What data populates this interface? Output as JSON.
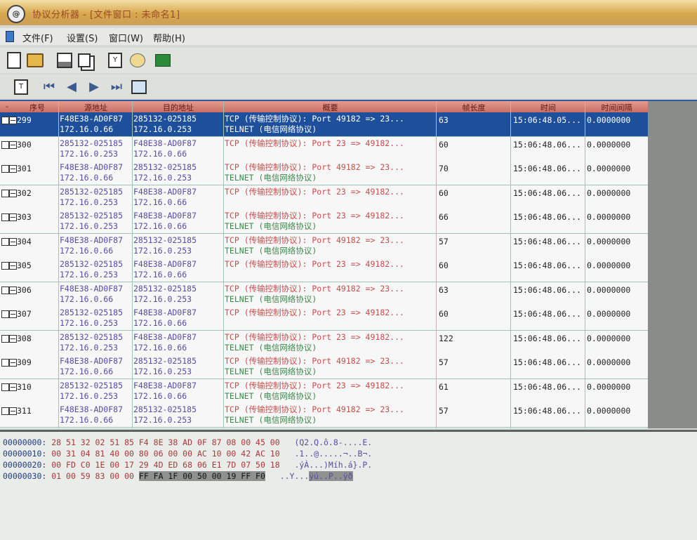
{
  "window": {
    "title": "协议分析器 - [文件窗口 : 未命名1]"
  },
  "menu": [
    "文件(F)",
    "设置(S)",
    "窗口(W)",
    "帮助(H)"
  ],
  "columns": [
    "序号",
    "源地址",
    "目的地址",
    "概要",
    "帧长度",
    "时间",
    "时间间隔"
  ],
  "rows": [
    {
      "seq": "299",
      "src_mac": "F48E38-AD0F87",
      "src_ip": "172.16.0.66",
      "dst_mac": "285132-025185",
      "dst_ip": "172.16.0.253",
      "sum1": "TCP (传输控制协议): Port 49182 => 23...",
      "sum2": "TELNET (电信网络协议)",
      "len": "63",
      "time": "15:06:48.05...",
      "gap": "0.0000000",
      "selected": true
    },
    {
      "seq": "300",
      "src_mac": "285132-025185",
      "src_ip": "172.16.0.253",
      "dst_mac": "F48E38-AD0F87",
      "dst_ip": "172.16.0.66",
      "sum1": "TCP (传输控制协议): Port 23 => 49182...",
      "sum2": "",
      "len": "60",
      "time": "15:06:48.06...",
      "gap": "0.0000000"
    },
    {
      "seq": "301",
      "src_mac": "F48E38-AD0F87",
      "src_ip": "172.16.0.66",
      "dst_mac": "285132-025185",
      "dst_ip": "172.16.0.253",
      "sum1": "TCP (传输控制协议): Port 49182 => 23...",
      "sum2": "TELNET (电信网络协议)",
      "len": "70",
      "time": "15:06:48.06...",
      "gap": "0.0000000"
    },
    {
      "seq": "302",
      "src_mac": "285132-025185",
      "src_ip": "172.16.0.253",
      "dst_mac": "F48E38-AD0F87",
      "dst_ip": "172.16.0.66",
      "sum1": "TCP (传输控制协议): Port 23 => 49182...",
      "sum2": "",
      "len": "60",
      "time": "15:06:48.06...",
      "gap": "0.0000000"
    },
    {
      "seq": "303",
      "src_mac": "285132-025185",
      "src_ip": "172.16.0.253",
      "dst_mac": "F48E38-AD0F87",
      "dst_ip": "172.16.0.66",
      "sum1": "TCP (传输控制协议): Port 23 => 49182...",
      "sum2": "TELNET (电信网络协议)",
      "len": "66",
      "time": "15:06:48.06...",
      "gap": "0.0000000"
    },
    {
      "seq": "304",
      "src_mac": "F48E38-AD0F87",
      "src_ip": "172.16.0.66",
      "dst_mac": "285132-025185",
      "dst_ip": "172.16.0.253",
      "sum1": "TCP (传输控制协议): Port 49182 => 23...",
      "sum2": "TELNET (电信网络协议)",
      "len": "57",
      "time": "15:06:48.06...",
      "gap": "0.0000000"
    },
    {
      "seq": "305",
      "src_mac": "285132-025185",
      "src_ip": "172.16.0.253",
      "dst_mac": "F48E38-AD0F87",
      "dst_ip": "172.16.0.66",
      "sum1": "TCP (传输控制协议): Port 23 => 49182...",
      "sum2": "",
      "len": "60",
      "time": "15:06:48.06...",
      "gap": "0.0000000"
    },
    {
      "seq": "306",
      "src_mac": "F48E38-AD0F87",
      "src_ip": "172.16.0.66",
      "dst_mac": "285132-025185",
      "dst_ip": "172.16.0.253",
      "sum1": "TCP (传输控制协议): Port 49182 => 23...",
      "sum2": "TELNET (电信网络协议)",
      "len": "63",
      "time": "15:06:48.06...",
      "gap": "0.0000000"
    },
    {
      "seq": "307",
      "src_mac": "285132-025185",
      "src_ip": "172.16.0.253",
      "dst_mac": "F48E38-AD0F87",
      "dst_ip": "172.16.0.66",
      "sum1": "TCP (传输控制协议): Port 23 => 49182...",
      "sum2": "",
      "len": "60",
      "time": "15:06:48.06...",
      "gap": "0.0000000"
    },
    {
      "seq": "308",
      "src_mac": "285132-025185",
      "src_ip": "172.16.0.253",
      "dst_mac": "F48E38-AD0F87",
      "dst_ip": "172.16.0.66",
      "sum1": "TCP (传输控制协议): Port 23 => 49182...",
      "sum2": "TELNET (电信网络协议)",
      "len": "122",
      "time": "15:06:48.06...",
      "gap": "0.0000000"
    },
    {
      "seq": "309",
      "src_mac": "F48E38-AD0F87",
      "src_ip": "172.16.0.66",
      "dst_mac": "285132-025185",
      "dst_ip": "172.16.0.253",
      "sum1": "TCP (传输控制协议): Port 49182 => 23...",
      "sum2": "TELNET (电信网络协议)",
      "len": "57",
      "time": "15:06:48.06...",
      "gap": "0.0000000"
    },
    {
      "seq": "310",
      "src_mac": "285132-025185",
      "src_ip": "172.16.0.253",
      "dst_mac": "F48E38-AD0F87",
      "dst_ip": "172.16.0.66",
      "sum1": "TCP (传输控制协议): Port 23 => 49182...",
      "sum2": "TELNET (电信网络协议)",
      "len": "61",
      "time": "15:06:48.06...",
      "gap": "0.0000000"
    },
    {
      "seq": "311",
      "src_mac": "F48E38-AD0F87",
      "src_ip": "172.16.0.66",
      "dst_mac": "285132-025185",
      "dst_ip": "172.16.0.253",
      "sum1": "TCP (传输控制协议): Port 49182 => 23...",
      "sum2": "TELNET (电信网络协议)",
      "len": "57",
      "time": "15:06:48.06...",
      "gap": "0.0000000"
    }
  ],
  "hex": [
    {
      "off": "00000000:",
      "bytes": "28 51 32 02 51 85 F4 8E 38 AD 0F 87 08 00 45 00",
      "ascii": "(Q2.Q.ô.8-....E."
    },
    {
      "off": "00000010:",
      "bytes": "00 31 04 81 40 00 80 06 00 00 AC 10 00 42 AC 10",
      "ascii": ".1..@.....¬..B¬."
    },
    {
      "off": "00000020:",
      "bytes": "00 FD C0 1E 00 17 29 4D ED 68 06 E1 7D 07 50 18",
      "ascii": ".ýÀ...)Míh.á}.P."
    },
    {
      "off": "00000030:",
      "bytes": "01 00 59 83 00 00",
      "bytes_hl": "FF FA 1F 00 50 00 19 FF F0",
      "ascii": "..Y...",
      "ascii_hl": "ÿú..P..ÿð"
    }
  ]
}
